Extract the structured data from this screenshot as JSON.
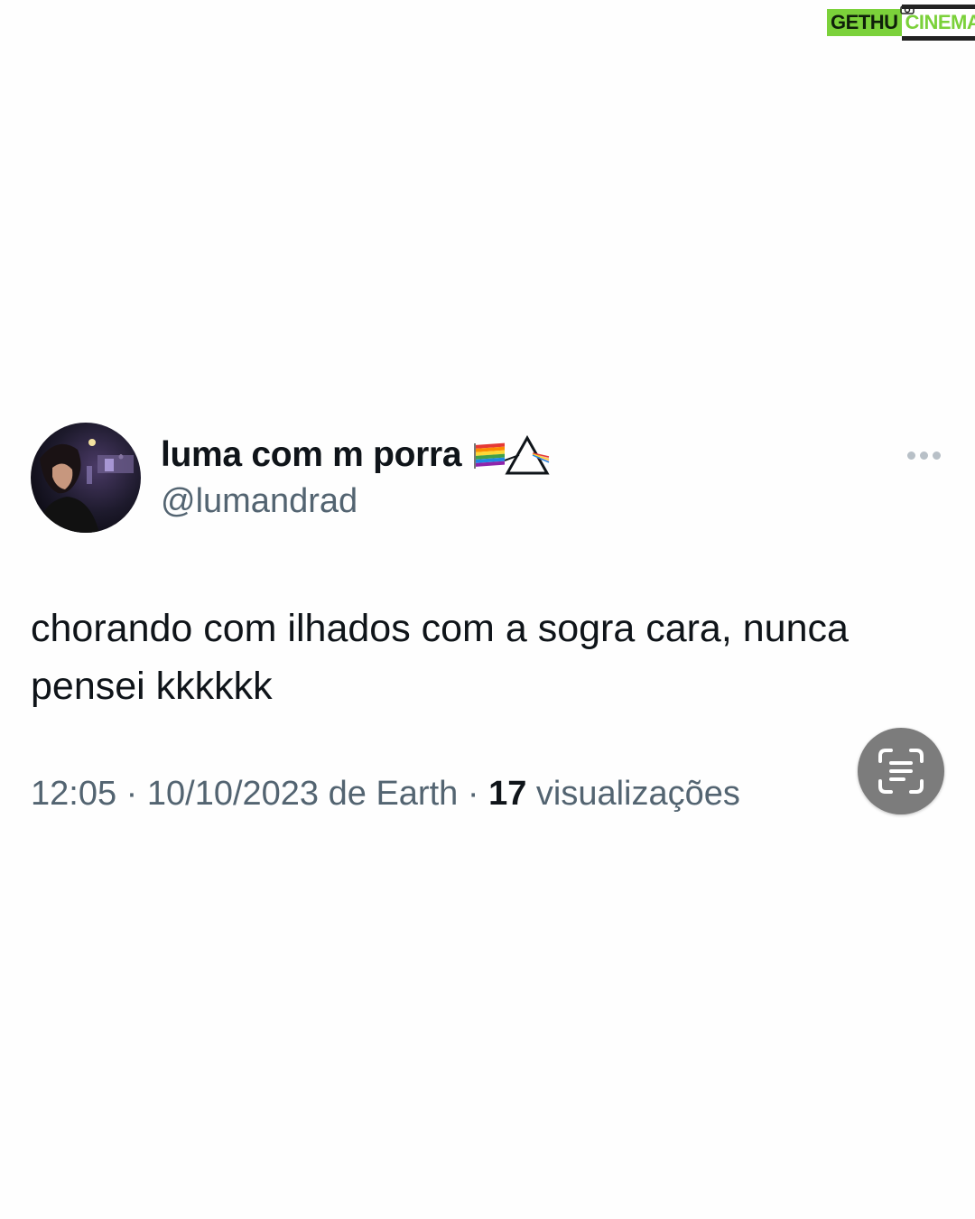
{
  "watermark": {
    "part1": "GETHU",
    "part2": "CINEMA"
  },
  "tweet": {
    "display_name": "luma com m porra",
    "name_emojis": [
      "rainbow-flag-icon",
      "prism-triangle-icon"
    ],
    "handle": "@lumandrad",
    "text": "chorando com ilhados com a sogra cara, nunca pensei kkkkkk",
    "time": "12:05",
    "date": "10/10/2023",
    "source": "de Earth",
    "separator": "·",
    "views_count": "17",
    "views_label": "visualizações"
  },
  "colors": {
    "text_primary": "#0f1419",
    "text_secondary": "#536471",
    "watermark_green": "#7bd13a",
    "scan_button": "#7c7c7c"
  },
  "icons": {
    "more": "more-dots-icon",
    "scan": "text-scan-icon"
  }
}
